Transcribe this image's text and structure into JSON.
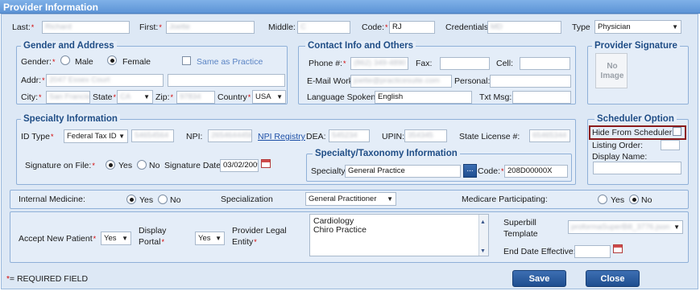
{
  "window": {
    "title": "Provider Information"
  },
  "provider": {
    "last_label": "Last:",
    "last_value": "Richard",
    "first_label": "First:",
    "first_value": "Joette",
    "middle_label": "Middle:",
    "middle_value": "C",
    "code_label": "Code:",
    "code_value": "RJ",
    "credentials_label": "Credentials:",
    "credentials_value": "MD",
    "type_label": "Type",
    "type_value": "Physician"
  },
  "gender_address": {
    "legend": "Gender and Address",
    "gender_label": "Gender:",
    "male": "Male",
    "female": "Female",
    "same_as_practice": "Same as Practice",
    "addr_label": "Addr:",
    "addr_value": "2047 Essex Court",
    "city_label": "City:",
    "city_value": "San Francisco",
    "state_label": "State",
    "state_value": "CA",
    "zip_label": "Zip:",
    "zip_value": "97834",
    "country_label": "Country",
    "country_value": "USA"
  },
  "contact": {
    "legend": "Contact Info and Others",
    "phone_label": "Phone #:",
    "phone_value": "(862) 349-4890",
    "fax_label": "Fax:",
    "cell_label": "Cell:",
    "email_work_label": "E-Mail Work:",
    "email_work_value": "joette@practicesuite.com",
    "personal_label": "Personal:",
    "language_label": "Language Spoken:",
    "language_value": "English",
    "txtmsg_label": "Txt Msg:"
  },
  "signature": {
    "legend": "Provider Signature",
    "no_image": "No Image"
  },
  "specialty": {
    "legend": "Specialty Information",
    "id_type_label": "ID Type",
    "id_type_value": "Federal Tax ID",
    "id_value": "54654564",
    "npi_label": "NPI:",
    "npi_value": "2654644456",
    "npi_registry": "NPI Registry",
    "dea_label": "DEA:",
    "dea_value": "545234",
    "upin_label": "UPIN:",
    "upin_value": "354345",
    "state_license_label": "State License #:",
    "state_license_value": "65465344",
    "signature_on_file_label": "Signature on File:",
    "yes": "Yes",
    "no": "No",
    "signature_date_label": "Signature Date:",
    "signature_date_value": "03/02/2009"
  },
  "taxonomy": {
    "legend": "Specialty/Taxonomy Information",
    "specialty_label": "Specialty",
    "specialty_value": "General Practice",
    "browse": "...",
    "code_label": "Code:",
    "code_value": "208D00000X"
  },
  "scheduler": {
    "legend": "Scheduler Option",
    "hide_label": "Hide From Scheduler:",
    "listing_order_label": "Listing Order:",
    "display_name_label": "Display Name:"
  },
  "row_internal": {
    "internal_medicine_label": "Internal Medicine:",
    "yes": "Yes",
    "no": "No",
    "specialization_label": "Specialization",
    "specialization_value": "General Practitioner",
    "medicare_label": "Medicare Participating:"
  },
  "row_bottom": {
    "accept_label": "Accept New Patient",
    "accept_value": "Yes",
    "display_portal_label_1": "Display",
    "display_portal_label_2": "Portal",
    "display_portal_value": "Yes",
    "legal_entity_label_1": "Provider Legal",
    "legal_entity_label_2": "Entity",
    "legal_entities": [
      "Cardiology",
      "Chiro Practice"
    ],
    "superbill_label_1": "Superbill",
    "superbill_label_2": "Template",
    "superbill_value": "proformaSuperBill_3776.json",
    "end_date_label": "End Date Effective:"
  },
  "footer": {
    "required_note": "= REQUIRED FIELD",
    "required_star": "*",
    "save": "Save",
    "close": "Close"
  },
  "colors": {
    "accent": "#1f4e8f",
    "required": "#d40000",
    "highlight_border": "#8b1a1a"
  },
  "icons": [
    "calendar-icon",
    "chevron-down-icon",
    "scroll-up-icon",
    "scroll-down-icon",
    "browse-icon",
    "no-image-icon"
  ]
}
